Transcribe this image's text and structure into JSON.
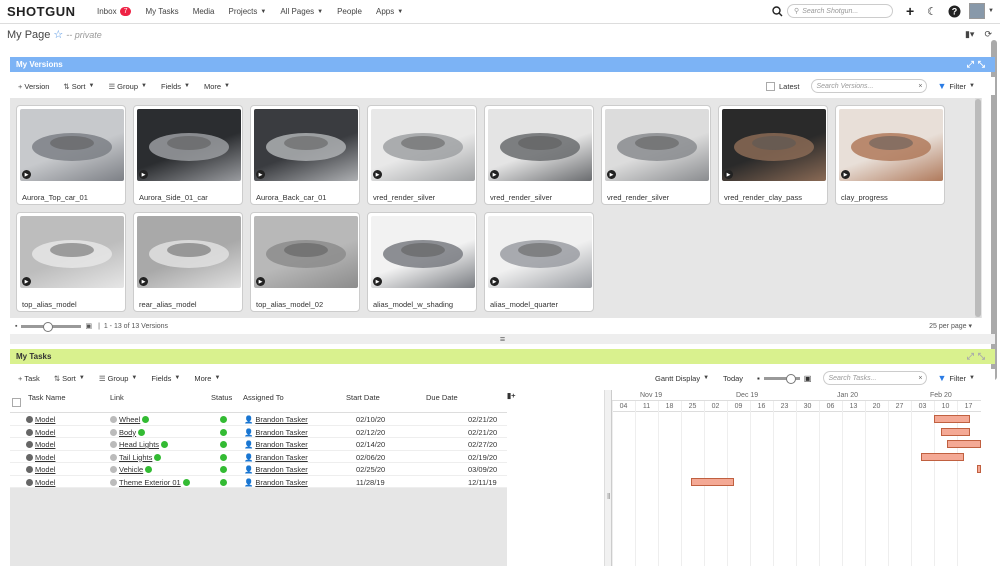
{
  "nav": {
    "logo": "SHOTGUN",
    "inbox": "Inbox",
    "inbox_count": "7",
    "my_tasks": "My Tasks",
    "media": "Media",
    "projects": "Projects",
    "all_pages": "All Pages",
    "people": "People",
    "apps": "Apps",
    "search_placeholder": "Search Shotgun..."
  },
  "page": {
    "title": "My Page",
    "privacy": "-- private"
  },
  "versions": {
    "header": "My Versions",
    "toolbar": {
      "add": "Version",
      "sort": "Sort",
      "group": "Group",
      "fields": "Fields",
      "more": "More",
      "latest": "Latest",
      "search_placeholder": "Search Versions...",
      "filter": "Filter"
    },
    "items": [
      {
        "name": "Aurora_Top_car_01"
      },
      {
        "name": "Aurora_Side_01_car"
      },
      {
        "name": "Aurora_Back_car_01"
      },
      {
        "name": "vred_render_silver"
      },
      {
        "name": "vred_render_silver"
      },
      {
        "name": "vred_render_silver"
      },
      {
        "name": "vred_render_clay_pass"
      },
      {
        "name": "clay_progress"
      },
      {
        "name": "top_alias_model"
      },
      {
        "name": "rear_alias_model"
      },
      {
        "name": "top_alias_model_02"
      },
      {
        "name": "alias_model_w_shading"
      },
      {
        "name": "alias_model_quarter"
      }
    ],
    "footer_count": "1 - 13 of 13 Versions",
    "per_page": "25 per page"
  },
  "tasks": {
    "header": "My Tasks",
    "toolbar": {
      "add": "Task",
      "sort": "Sort",
      "group": "Group",
      "fields": "Fields",
      "more": "More",
      "gantt": "Gantt Display",
      "today": "Today",
      "search_placeholder": "Search Tasks...",
      "filter": "Filter"
    },
    "columns": {
      "task": "Task Name",
      "link": "Link",
      "status": "Status",
      "assigned": "Assigned To",
      "start": "Start Date",
      "due": "Due Date"
    },
    "rows": [
      {
        "task": "Model",
        "link": "Wheel",
        "assigned": "Brandon Tasker",
        "start": "02/10/20",
        "due": "02/21/20"
      },
      {
        "task": "Model",
        "link": "Body",
        "assigned": "Brandon Tasker",
        "start": "02/12/20",
        "due": "02/21/20"
      },
      {
        "task": "Model",
        "link": "Head Lights",
        "assigned": "Brandon Tasker",
        "start": "02/14/20",
        "due": "02/27/20"
      },
      {
        "task": "Model",
        "link": "Tail Lights",
        "assigned": "Brandon Tasker",
        "start": "02/06/20",
        "due": "02/19/20"
      },
      {
        "task": "Model",
        "link": "Vehicle",
        "assigned": "Brandon Tasker",
        "start": "02/25/20",
        "due": "03/09/20"
      },
      {
        "task": "Model",
        "link": "Theme Exterior 01",
        "assigned": "Brandon Tasker",
        "start": "11/28/19",
        "due": "12/11/19"
      }
    ],
    "gantt": {
      "months": [
        "Nov 19",
        "Dec 19",
        "Jan 20",
        "Feb 20"
      ],
      "days": [
        "04",
        "11",
        "18",
        "25",
        "02",
        "09",
        "16",
        "23",
        "30",
        "06",
        "13",
        "20",
        "27",
        "03",
        "10",
        "17"
      ]
    }
  }
}
